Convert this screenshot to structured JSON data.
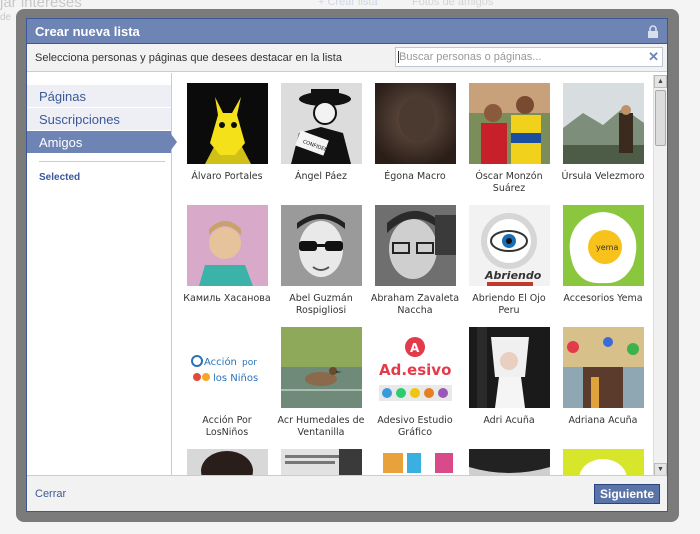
{
  "background": {
    "page_title_fragment": "jar intereses",
    "create_list_fragment": "+ Crear lista",
    "photos_fragment": "Fotos de amigos",
    "sub_fragment": "de"
  },
  "dialog": {
    "title": "Crear nueva lista",
    "instruction": "Selecciona personas y páginas que desees destacar en la lista",
    "search_placeholder": "Buscar personas o páginas..."
  },
  "sidebar": {
    "items": [
      {
        "label": "Páginas",
        "selected": false
      },
      {
        "label": "Suscripciones",
        "selected": false
      },
      {
        "label": "Amigos",
        "selected": true
      }
    ],
    "selected_label": "Selected"
  },
  "people": [
    {
      "name": "Álvaro Portales",
      "thumb": "goat-yellow"
    },
    {
      "name": "Ángel Páez",
      "thumb": "detective"
    },
    {
      "name": "Égona Macro",
      "thumb": "dark-brown"
    },
    {
      "name": "Óscar Monzón Suárez",
      "thumb": "group-photo"
    },
    {
      "name": "Úrsula Velezmoro",
      "thumb": "mountain"
    },
    {
      "name": "Камиль Хасанова",
      "thumb": "boy-pink"
    },
    {
      "name": "Abel Guzmán Rospigliosi",
      "thumb": "sunglasses-bw"
    },
    {
      "name": "Abraham Zavaleta Naccha",
      "thumb": "glasses-bw"
    },
    {
      "name": "Abriendo El Ojo Peru",
      "thumb": "eye-logo"
    },
    {
      "name": "Accesorios Yema",
      "thumb": "egg"
    },
    {
      "name": "Acción Por LosNiños",
      "thumb": "accion-logo"
    },
    {
      "name": "Acr Humedales de Ventanilla",
      "thumb": "duck"
    },
    {
      "name": "Adesivo Estudio Gráfico",
      "thumb": "adesivo-logo"
    },
    {
      "name": "Adri Acuña",
      "thumb": "cosplay"
    },
    {
      "name": "Adriana Acuña",
      "thumb": "wall"
    },
    {
      "name": "",
      "thumb": "partial-woman"
    },
    {
      "name": "",
      "thumb": "partial-text"
    },
    {
      "name": "",
      "thumb": "partial-colors"
    },
    {
      "name": "",
      "thumb": "partial-gray"
    },
    {
      "name": "",
      "thumb": "partial-green"
    }
  ],
  "footer": {
    "cancel_label": "Cerrar",
    "next_label": "Siguiente"
  },
  "colors": {
    "header_blue": "#6d84b4",
    "border_blue": "#3b5998",
    "link_blue": "#3b5998",
    "button_blue": "#5b74a8"
  }
}
